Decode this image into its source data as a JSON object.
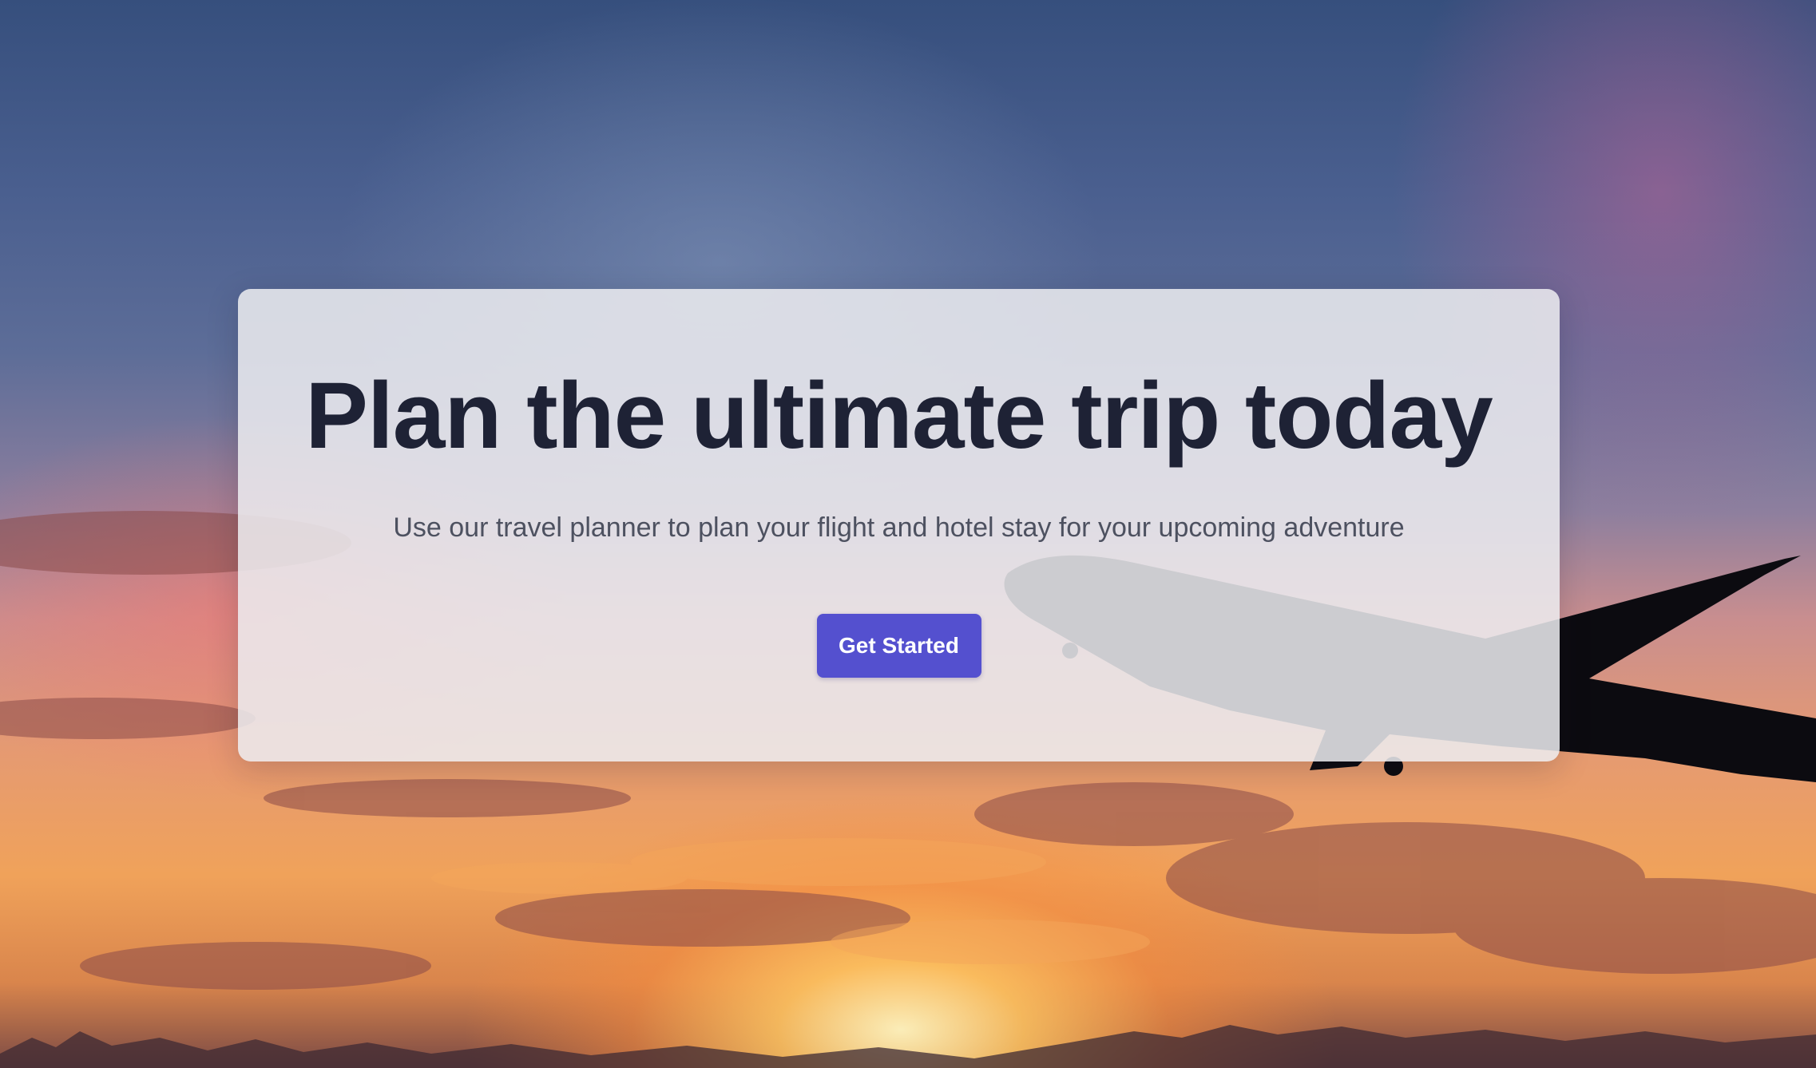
{
  "hero": {
    "title": "Plan the ultimate trip today",
    "subtitle": "Use our travel planner to plan your flight and hotel stay for your upcoming adventure",
    "cta_label": "Get Started",
    "background": "sunset-sky-airplane-photo"
  },
  "colors": {
    "title": "#1e2235",
    "subtitle": "#4d5160",
    "cta_background": "#5450cf",
    "cta_text": "#ffffff",
    "card_background": "#ececf0"
  }
}
